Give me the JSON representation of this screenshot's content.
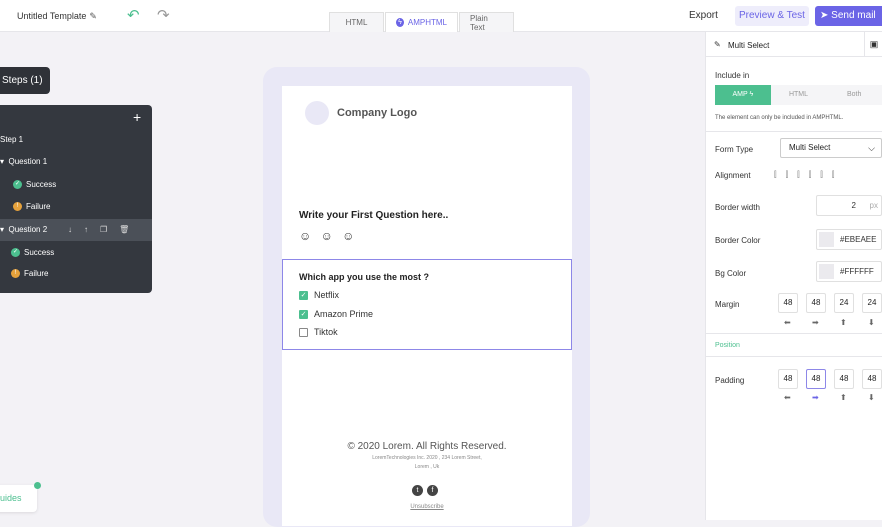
{
  "topbar": {
    "title": "Untitled Template",
    "tabs": [
      "HTML",
      "AMPHTML",
      "Plain Text"
    ],
    "export": "Export",
    "preview": "Preview & Test",
    "send": "Send mail"
  },
  "sidebar": {
    "steps_label": "Steps (1)",
    "step": "Step 1",
    "question1": "Question 1",
    "success1": "Success",
    "failure1": "Failure",
    "question2": "Question 2",
    "success2": "Success",
    "failure2": "Failure",
    "guides": "uides"
  },
  "email": {
    "logo": "Company Logo",
    "question": "Write your First Question here..",
    "smileys": "☺ ☺ ☺",
    "multi_question": "Which app you use the most ?",
    "options": [
      {
        "label": "Netflix",
        "checked": true
      },
      {
        "label": "Amazon Prime",
        "checked": true
      },
      {
        "label": "Tiktok",
        "checked": false
      }
    ],
    "copyright": "© 2020 Lorem. All Rights Reserved.",
    "address1": "LoremTechnologies Inc. 2020 , 234 Lorem Street,",
    "address2": "Lorem , Uk",
    "unsubscribe": "Unsubscribe"
  },
  "panel": {
    "title": "Multi Select",
    "include_in": "Include in",
    "include_options": [
      "AMP",
      "HTML",
      "Both"
    ],
    "note": "The element can only be included in AMPHTML.",
    "form_type_label": "Form Type",
    "form_type_value": "Multi Select",
    "alignment_label": "Alignment",
    "border_width_label": "Border width",
    "border_width_value": "2",
    "border_width_unit": "px",
    "border_color_label": "Border Color",
    "border_color_value": "#EBEAEE",
    "bg_color_label": "Bg Color",
    "bg_color_value": "#FFFFFF",
    "margin_label": "Margin",
    "margin_values": [
      "48",
      "48",
      "24",
      "24"
    ],
    "position_label": "Position",
    "padding_label": "Padding",
    "padding_values": [
      "48",
      "48",
      "48",
      "48"
    ]
  },
  "colors": {
    "accent": "#6b64e6",
    "green": "#4cbf8f",
    "dark": "#34383f"
  }
}
